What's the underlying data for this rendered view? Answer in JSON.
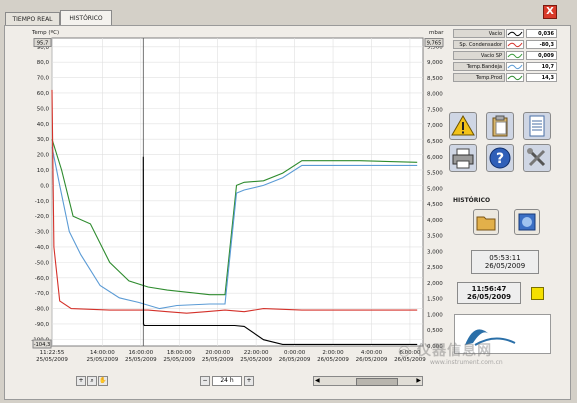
{
  "window": {
    "tabs": [
      {
        "label": "TIEMPO REAL"
      },
      {
        "label": "HISTÓRICO"
      }
    ],
    "close_label": "X"
  },
  "legend": [
    {
      "label": "Vacío",
      "value": "0,036",
      "color": "#000000"
    },
    {
      "label": "Sp. Condensador",
      "value": "-80,3",
      "color": "#d4312a"
    },
    {
      "label": "Vacío SP",
      "value": "0,009",
      "color": "#3c9b3c"
    },
    {
      "label": "Temp.Bandeja",
      "value": "10,7",
      "color": "#5b9bd5"
    },
    {
      "label": "Temp.Prod",
      "value": "14,3",
      "color": "#2e8b2e"
    }
  ],
  "history_label": "HISTÓRICO",
  "cursor_time": "05:53:11",
  "cursor_date": "26/05/2009",
  "clock_time": "11:56:47",
  "clock_date": "26/05/2009",
  "zoom_value": "24 h",
  "chart_data": {
    "type": "line",
    "ylabel_left": "Temp (ºC)",
    "ylabel_right": "mbar",
    "y_left_top_box": "95,7",
    "y_left_bottom_box": "-104,3",
    "y_right_top_box": "9,765",
    "y_left_ticks": [
      "90,0",
      "80,0",
      "70,0",
      "60,0",
      "50,0",
      "40,0",
      "30,0",
      "20,0",
      "10,0",
      "0,0",
      "-10,0",
      "-20,0",
      "-30,0",
      "-40,0",
      "-50,0",
      "-60,0",
      "-70,0",
      "-80,0",
      "-90,0",
      "-100,0"
    ],
    "y_right_ticks": [
      "9,500",
      "9,000",
      "8,500",
      "8,000",
      "7,500",
      "7,000",
      "6,500",
      "6,000",
      "5,500",
      "5,000",
      "4,500",
      "4,000",
      "3,500",
      "3,000",
      "2,500",
      "2,000",
      "1,500",
      "1,000",
      "0,500",
      "0,000"
    ],
    "x_ticks": [
      {
        "time": "11:22:55",
        "date": "25/05/2009"
      },
      {
        "time": "14:00:00",
        "date": "25/05/2009"
      },
      {
        "time": "16:00:00",
        "date": "25/05/2009"
      },
      {
        "time": "18:00:00",
        "date": "25/05/2009"
      },
      {
        "time": "20:00:00",
        "date": "25/05/2009"
      },
      {
        "time": "22:00:00",
        "date": "25/05/2009"
      },
      {
        "time": "0:00:00",
        "date": "26/05/2009"
      },
      {
        "time": "2:00:00",
        "date": "26/05/2009"
      },
      {
        "time": "4:00:00",
        "date": "26/05/2009"
      },
      {
        "time": "6:00:00",
        "date": "26/05/2009"
      }
    ],
    "x_hours": [
      0,
      2.62,
      4.62,
      6.62,
      8.62,
      10.62,
      12.62,
      14.62,
      16.62,
      18.62
    ],
    "ylim_left": [
      -104.3,
      95.7
    ],
    "ylim_right": [
      0,
      9.765
    ],
    "series": [
      {
        "name": "Temp.Prod",
        "color": "#2e8b2e",
        "axis": "left",
        "points": [
          [
            0,
            30
          ],
          [
            0.5,
            10
          ],
          [
            1.1,
            -20
          ],
          [
            2,
            -25
          ],
          [
            3,
            -50
          ],
          [
            4,
            -62
          ],
          [
            5,
            -66
          ],
          [
            6,
            -68
          ],
          [
            8.2,
            -71
          ],
          [
            9,
            -71
          ],
          [
            9.6,
            0
          ],
          [
            10,
            2
          ],
          [
            11,
            3
          ],
          [
            12,
            8
          ],
          [
            13,
            16
          ],
          [
            16,
            16
          ],
          [
            19,
            15
          ]
        ]
      },
      {
        "name": "Temp.Bandeja",
        "color": "#5b9bd5",
        "axis": "left",
        "points": [
          [
            0,
            25
          ],
          [
            0.4,
            0
          ],
          [
            0.9,
            -30
          ],
          [
            1.5,
            -45
          ],
          [
            2.5,
            -65
          ],
          [
            3.5,
            -73
          ],
          [
            4.5,
            -76
          ],
          [
            5.6,
            -80
          ],
          [
            6.5,
            -78
          ],
          [
            8.2,
            -77
          ],
          [
            9,
            -77
          ],
          [
            9.6,
            -5
          ],
          [
            10,
            -3
          ],
          [
            11,
            0
          ],
          [
            12,
            5
          ],
          [
            13,
            13
          ],
          [
            16,
            13
          ],
          [
            19,
            13
          ]
        ]
      },
      {
        "name": "Sp. Condensador",
        "color": "#d4312a",
        "axis": "left",
        "points": [
          [
            0,
            62
          ],
          [
            0.1,
            -40
          ],
          [
            0.4,
            -75
          ],
          [
            1,
            -80
          ],
          [
            3,
            -81
          ],
          [
            5,
            -81
          ],
          [
            6,
            -82
          ],
          [
            7,
            -83
          ],
          [
            8,
            -82
          ],
          [
            9,
            -81
          ],
          [
            10,
            -82
          ],
          [
            11,
            -80
          ],
          [
            13,
            -81
          ],
          [
            16,
            -81
          ],
          [
            19,
            -81
          ]
        ]
      },
      {
        "name": "Vacío",
        "color": "#000000",
        "axis": "right",
        "points": [
          [
            4.75,
            6.0
          ],
          [
            4.76,
            0.7
          ],
          [
            4.8,
            0.65
          ],
          [
            9.5,
            0.65
          ],
          [
            10,
            0.62
          ],
          [
            11,
            0.2
          ],
          [
            12,
            0.05
          ],
          [
            19,
            0.05
          ]
        ]
      }
    ]
  }
}
